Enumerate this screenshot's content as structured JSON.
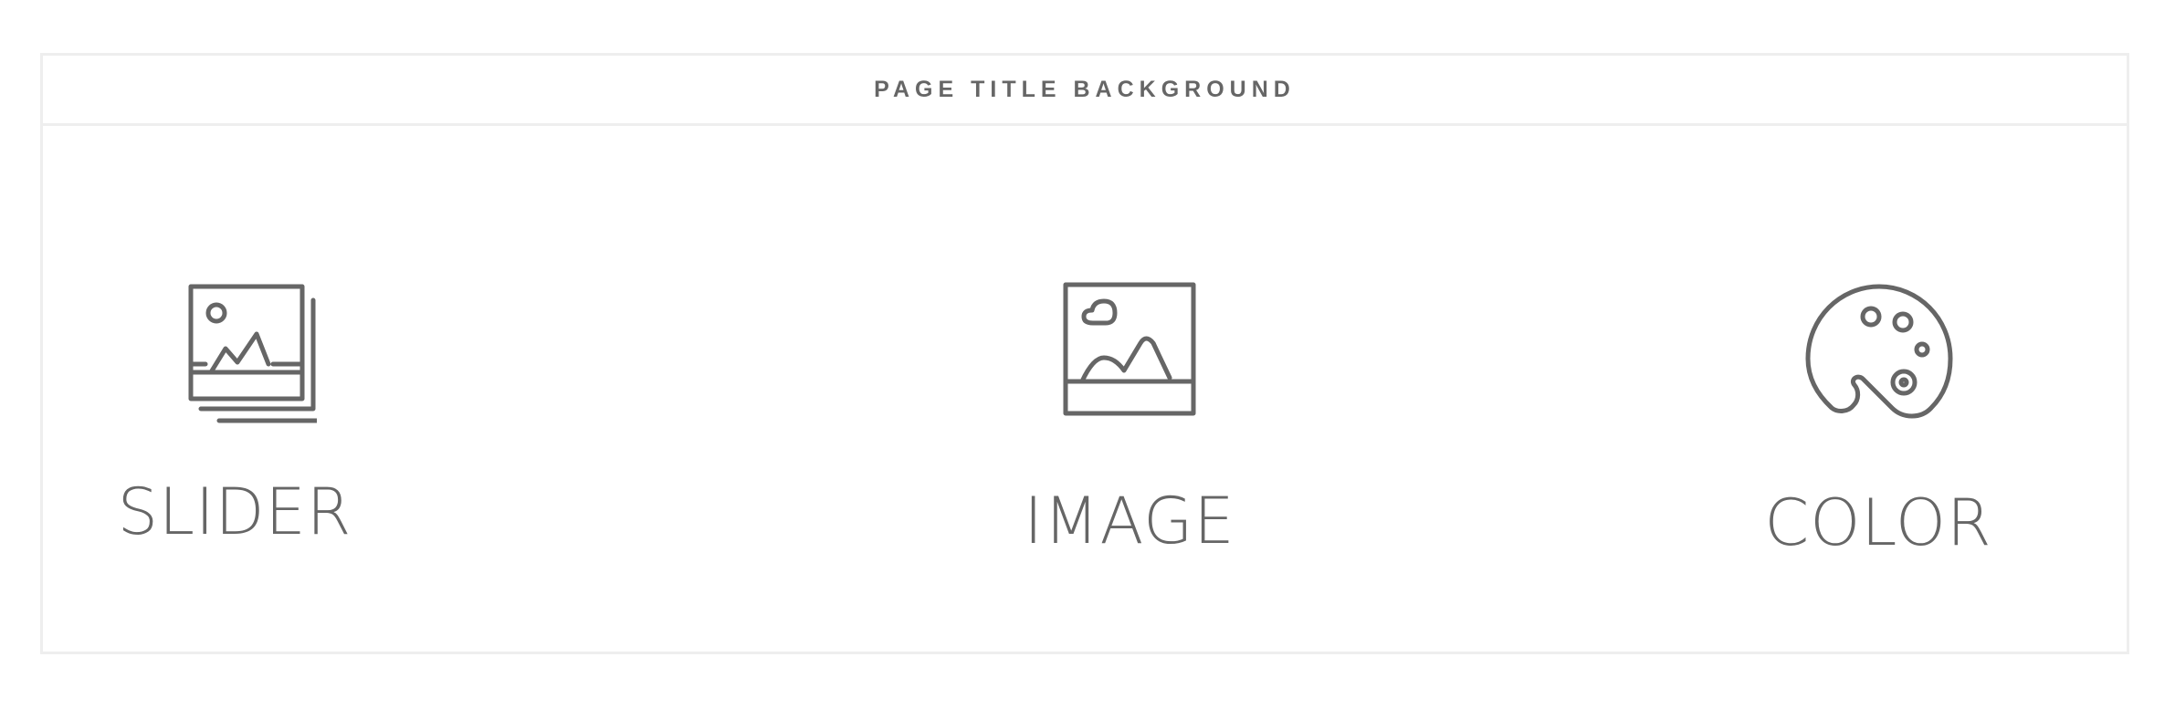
{
  "panel": {
    "title": "PAGE TITLE BACKGROUND"
  },
  "options": {
    "slider": {
      "label": "SLIDER",
      "icon": "image-stack-icon"
    },
    "image": {
      "label": "IMAGE",
      "icon": "image-icon"
    },
    "color": {
      "label": "COLOR",
      "icon": "palette-icon"
    }
  },
  "colors": {
    "text": "#666666",
    "border": "#eeeeee",
    "background": "#ffffff"
  }
}
